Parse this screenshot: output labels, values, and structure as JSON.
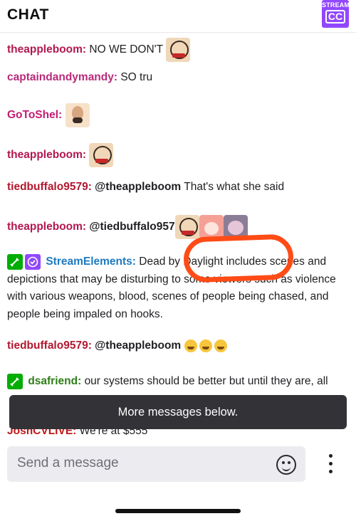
{
  "header": {
    "title": "CHAT",
    "stream_label": "STREAM",
    "cc_label": "CC"
  },
  "messages": [
    {
      "user": "theappleboom:",
      "user_color": "#b2184f",
      "text": "NO WE DON'T",
      "emotes": [
        "apple-emote"
      ]
    },
    {
      "user": "captaindandymandy:",
      "user_color": "#b92a7a",
      "text": "SO tru"
    },
    {
      "user": "GoToShel:",
      "user_color": "#c31c73",
      "text": "",
      "emotes": [
        "bald-emote"
      ]
    },
    {
      "user": "theappleboom:",
      "user_color": "#b2184f",
      "text": "",
      "emotes": [
        "apple-emote"
      ]
    },
    {
      "user": "tiedbuffalo9579:",
      "user_color": "#b2182f",
      "mention": "@theappleboom",
      "text": "That's what she said"
    },
    {
      "user": "theappleboom:",
      "user_color": "#b2184f",
      "mention": "@tiedbuffalo957",
      "text": "",
      "emotes": [
        "apple-emote",
        "redhair-emote",
        "pinkhair-emote"
      ]
    },
    {
      "user": "StreamElements:",
      "user_color": "#1e7ac1",
      "badges": [
        "moderator-badge",
        "verified-badge"
      ],
      "text": "Dead by Daylight includes scenes and depictions that may be disturbing to some viewers such as violence with various weapons, blood, scenes of people being chased, and people being impaled on hooks."
    },
    {
      "user": "tiedbuffalo9579:",
      "user_color": "#b2182f",
      "mention": "@theappleboom",
      "text": "",
      "emojis": [
        "sweat-smile",
        "joy",
        "rofl"
      ]
    },
    {
      "user": "dsafriend:",
      "user_color": "#2f7d18",
      "badges": [
        "moderator-badge"
      ],
      "text": "our systems should be better but until they are, all"
    },
    {
      "user": "JosnCVLIVE:",
      "user_color": "#c01818",
      "text": "We're at $555"
    }
  ],
  "toast": "More messages below.",
  "input": {
    "placeholder": "Send a message"
  },
  "colors": {
    "accent": "#9147ff",
    "annotation_circle": "#ff4b16",
    "mod_badge": "#00ad03"
  }
}
